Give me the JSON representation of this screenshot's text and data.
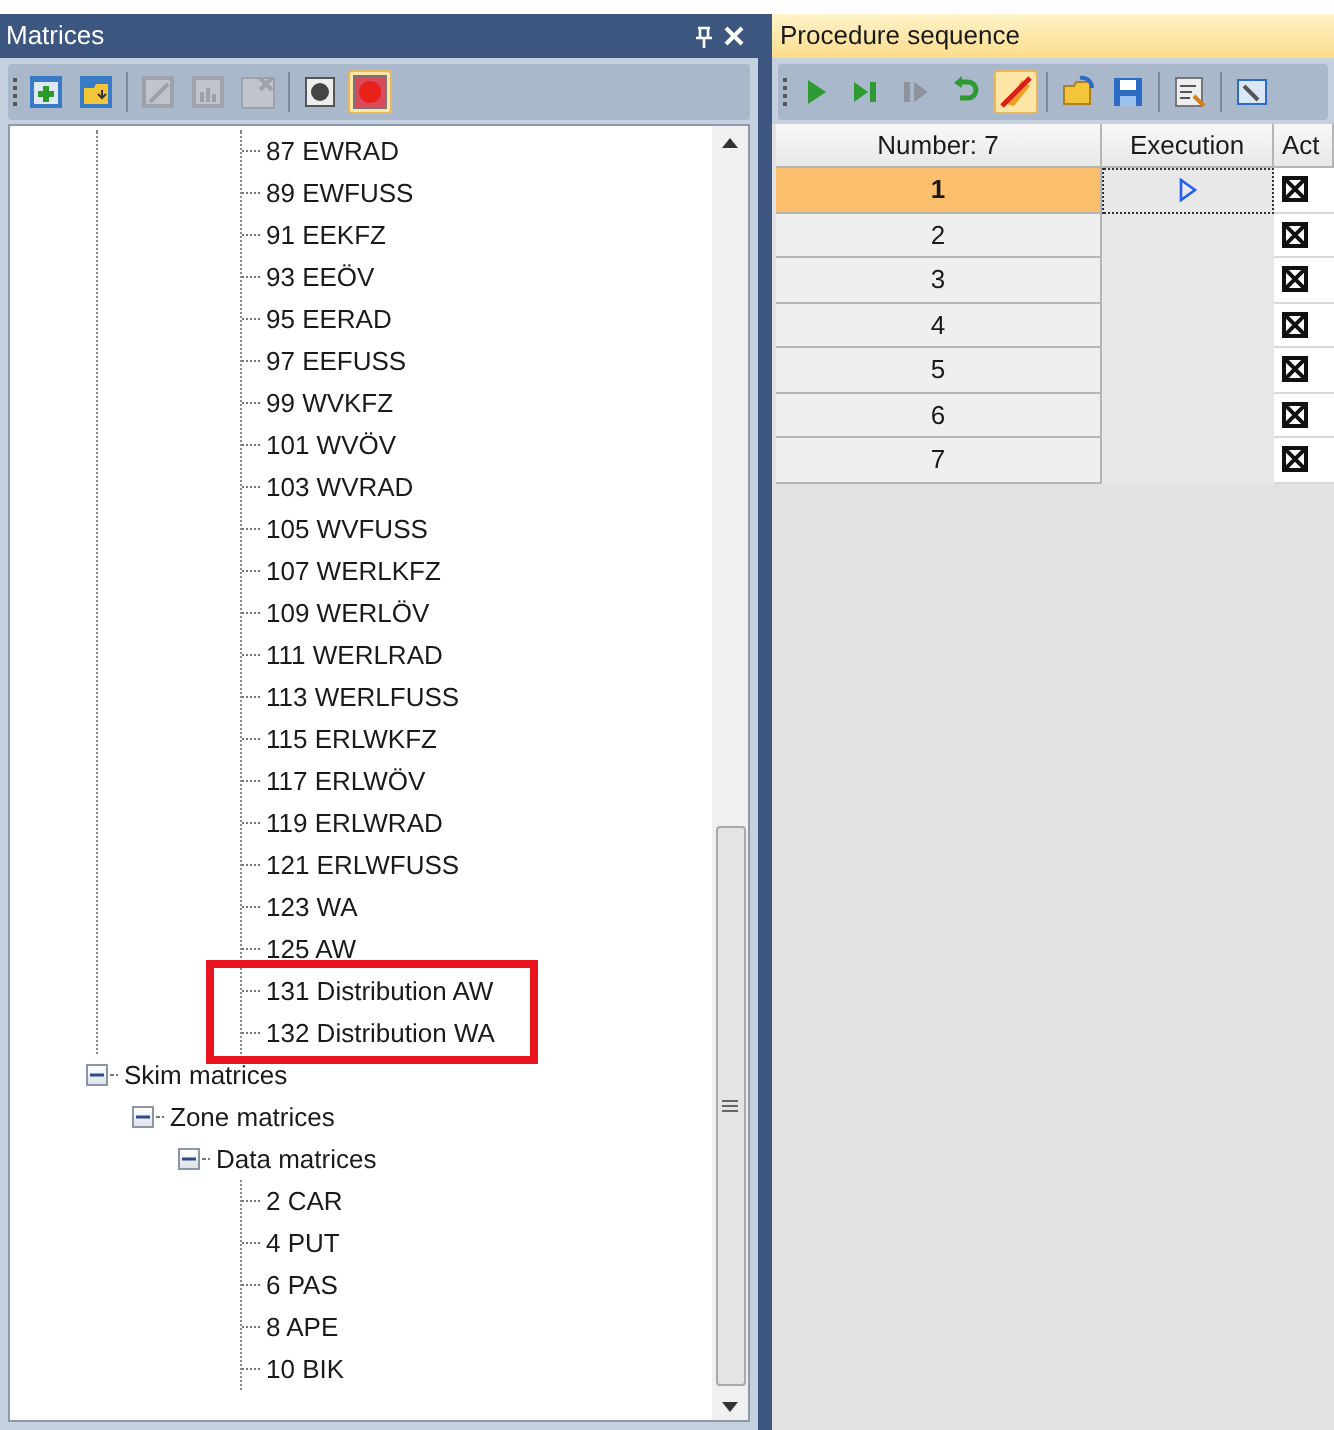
{
  "matrices_panel": {
    "title": "Matrices",
    "toolbar": [
      {
        "kind": "add",
        "disabled": false,
        "selected": false
      },
      {
        "kind": "open",
        "disabled": false,
        "selected": false
      },
      {
        "kind": "edit",
        "disabled": true,
        "selected": false
      },
      {
        "kind": "chart",
        "disabled": true,
        "selected": false
      },
      {
        "kind": "delete",
        "disabled": true,
        "selected": false
      },
      {
        "kind": "grey-dot",
        "disabled": false,
        "selected": false
      },
      {
        "kind": "red-dot",
        "disabled": false,
        "selected": true
      }
    ],
    "tree": {
      "continued_items": [
        {
          "label": "87 EWRAD",
          "highlighted": false
        },
        {
          "label": "89 EWFUSS",
          "highlighted": false
        },
        {
          "label": "91 EEKFZ",
          "highlighted": false
        },
        {
          "label": "93 EEÖV",
          "highlighted": false
        },
        {
          "label": "95 EERAD",
          "highlighted": false
        },
        {
          "label": "97 EEFUSS",
          "highlighted": false
        },
        {
          "label": "99 WVKFZ",
          "highlighted": false
        },
        {
          "label": "101 WVÖV",
          "highlighted": false
        },
        {
          "label": "103 WVRAD",
          "highlighted": false
        },
        {
          "label": "105 WVFUSS",
          "highlighted": false
        },
        {
          "label": "107 WERLKFZ",
          "highlighted": false
        },
        {
          "label": "109 WERLÖV",
          "highlighted": false
        },
        {
          "label": "111 WERLRAD",
          "highlighted": false
        },
        {
          "label": "113 WERLFUSS",
          "highlighted": false
        },
        {
          "label": "115 ERLWKFZ",
          "highlighted": false
        },
        {
          "label": "117 ERLWÖV",
          "highlighted": false
        },
        {
          "label": "119 ERLWRAD",
          "highlighted": false
        },
        {
          "label": "121 ERLWFUSS",
          "highlighted": false
        },
        {
          "label": "123 WA",
          "highlighted": false
        },
        {
          "label": "125 AW",
          "highlighted": false
        },
        {
          "label": "131 Distribution AW",
          "highlighted": true
        },
        {
          "label": "132 Distribution WA",
          "highlighted": true
        }
      ],
      "nodes": [
        {
          "label": "Skim matrices",
          "expanded": true,
          "children": [
            {
              "label": "Zone matrices",
              "expanded": true,
              "children": [
                {
                  "label": "Data matrices",
                  "expanded": true,
                  "children": [
                    {
                      "label": "2 CAR"
                    },
                    {
                      "label": "4 PUT"
                    },
                    {
                      "label": "6 PAS"
                    },
                    {
                      "label": "8 APE"
                    },
                    {
                      "label": "10 BIK"
                    }
                  ]
                }
              ]
            }
          ]
        }
      ]
    }
  },
  "procedure_panel": {
    "title": "Procedure sequence",
    "toolbar": [
      {
        "kind": "run",
        "disabled": false,
        "selected": false
      },
      {
        "kind": "step",
        "disabled": false,
        "selected": false
      },
      {
        "kind": "step-back",
        "disabled": true,
        "selected": false
      },
      {
        "kind": "undo",
        "disabled": false,
        "selected": false
      },
      {
        "kind": "no-edit",
        "disabled": false,
        "selected": true
      },
      {
        "kind": "open",
        "disabled": false,
        "selected": false
      },
      {
        "kind": "save",
        "disabled": false,
        "selected": false
      },
      {
        "kind": "properties",
        "disabled": false,
        "selected": false
      },
      {
        "kind": "settings",
        "disabled": false,
        "selected": false
      }
    ],
    "table": {
      "columns": [
        "Number: 7",
        "Execution",
        "Act"
      ],
      "rows": [
        {
          "number": "1",
          "selected": true,
          "current": true,
          "active": true
        },
        {
          "number": "2",
          "selected": false,
          "current": false,
          "active": true
        },
        {
          "number": "3",
          "selected": false,
          "current": false,
          "active": true
        },
        {
          "number": "4",
          "selected": false,
          "current": false,
          "active": true
        },
        {
          "number": "5",
          "selected": false,
          "current": false,
          "active": true
        },
        {
          "number": "6",
          "selected": false,
          "current": false,
          "active": true
        },
        {
          "number": "7",
          "selected": false,
          "current": false,
          "active": true
        }
      ]
    }
  }
}
